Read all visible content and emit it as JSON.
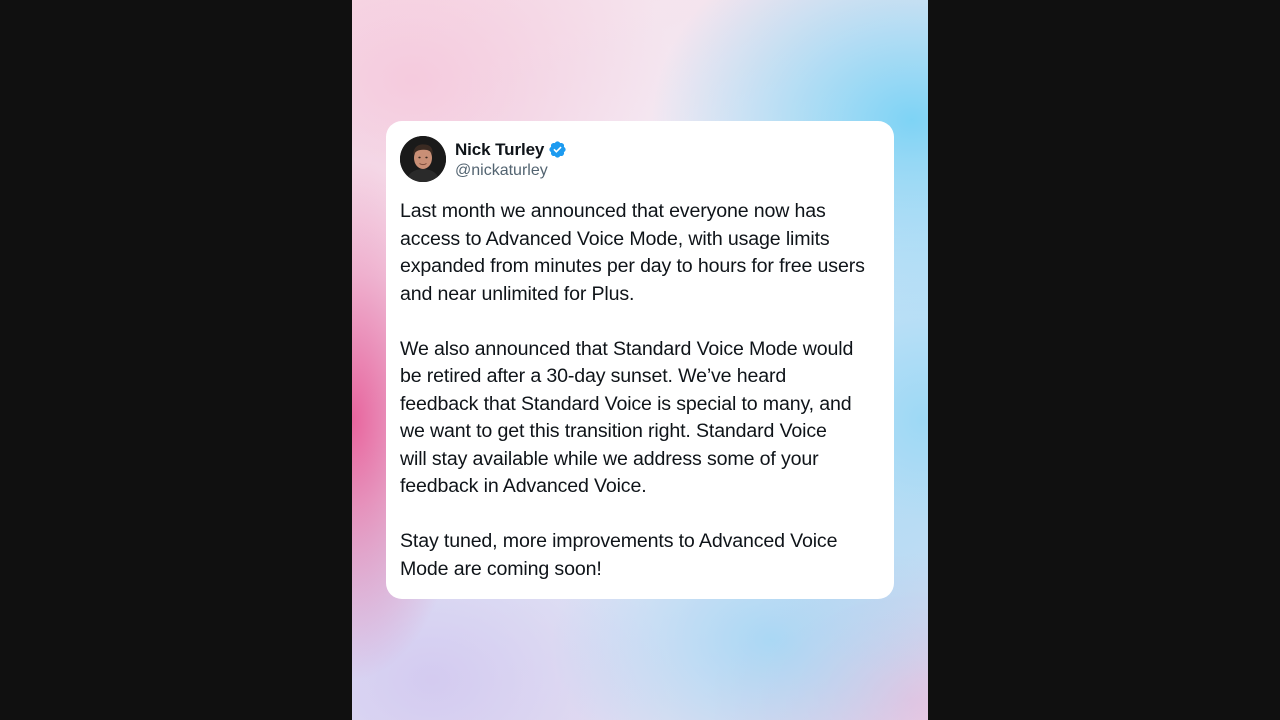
{
  "tweet": {
    "author": {
      "display_name": "Nick Turley",
      "handle": "@nickaturley",
      "verified": true,
      "avatar_icon": "profile-photo-avatar"
    },
    "paragraphs": [
      "Last month we announced that everyone now has\naccess to Advanced Voice Mode, with usage limits\nexpanded from minutes per day to hours for free users\nand near unlimited for Plus.",
      "We also announced that Standard Voice Mode would\nbe retired after a 30-day sunset. We’ve heard\nfeedback that Standard Voice is special to many, and\nwe want to get this transition right. Standard Voice\nwill stay available while we address some of your\nfeedback in Advanced Voice.",
      "Stay tuned, more improvements to Advanced Voice\nMode are coming soon!"
    ]
  },
  "colors": {
    "verified_badge": "#1d9bf0",
    "text_primary": "#0f1419",
    "text_secondary": "#536471",
    "card_background": "#ffffff",
    "letterbox": "#101010"
  }
}
